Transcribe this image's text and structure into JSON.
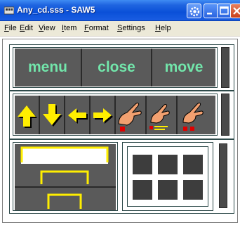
{
  "window": {
    "title": "Any_cd.sss - SAW5",
    "colors": {
      "titlebar": "#0a50d8",
      "title_text": "#ffffff",
      "close_btn": "#c8401a"
    }
  },
  "menubar": {
    "items": [
      {
        "label": "File",
        "accel": "F",
        "rest": "ile"
      },
      {
        "label": "Edit",
        "accel": "E",
        "rest": "dit"
      },
      {
        "label": "View",
        "accel": "V",
        "rest": "iew"
      },
      {
        "label": "Item",
        "accel": "I",
        "rest": "tem"
      },
      {
        "label": "Format",
        "accel": "F",
        "rest": "ormat"
      },
      {
        "label": "Settings",
        "accel": "S",
        "rest": "ettings"
      },
      {
        "label": "Help",
        "accel": "H",
        "rest": "elp"
      }
    ]
  },
  "panels": {
    "commands": {
      "buttons": [
        {
          "label": "menu",
          "icon": ""
        },
        {
          "label": "close",
          "icon": ""
        },
        {
          "label": "move",
          "icon": ""
        }
      ],
      "text_color": "#72e6ab"
    },
    "navigation": {
      "buttons": [
        {
          "icon": "arrow-up-icon"
        },
        {
          "icon": "arrow-down-icon"
        },
        {
          "icon": "arrow-left-icon"
        },
        {
          "icon": "arrow-right-icon"
        },
        {
          "icon": "hand-click-icon"
        },
        {
          "icon": "hand-drag-icon"
        },
        {
          "icon": "hand-double-click-icon"
        }
      ],
      "arrow_color": "#ffee00",
      "dot_color": "#e00000"
    },
    "layout": {
      "placement_icons": [
        "top-bracket-icon",
        "middle-bracket-icon",
        "bottom-bracket-icon"
      ],
      "grid_icon": "grid-icon",
      "bracket_color": "#ffee00"
    }
  },
  "colors": {
    "button_bg": "#5a5a5a",
    "panel_border": "#2e4a4a"
  }
}
